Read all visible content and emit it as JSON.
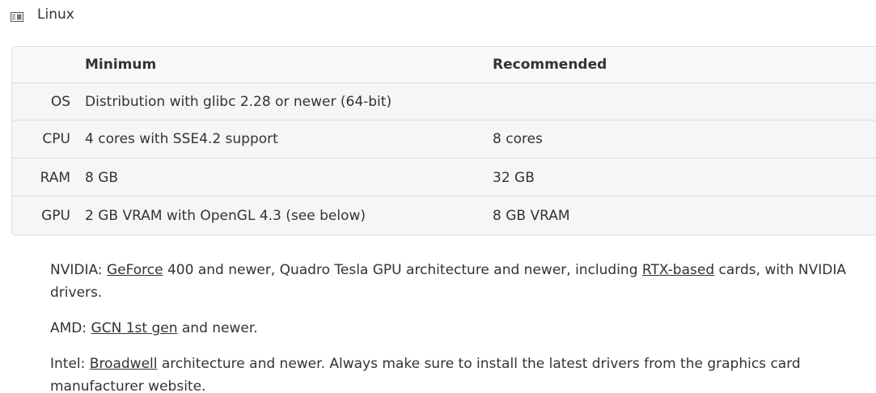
{
  "section": {
    "title": "Linux",
    "icon": "platform-icon"
  },
  "table": {
    "headers": {
      "label": "",
      "minimum": "Minimum",
      "recommended": "Recommended"
    },
    "rows": [
      {
        "label": "OS",
        "minimum": "Distribution with glibc 2.28 or newer (64-bit)",
        "recommended": ""
      },
      {
        "label": "CPU",
        "minimum": "4 cores with SSE4.2 support",
        "recommended": "8 cores"
      },
      {
        "label": "RAM",
        "minimum": "8 GB",
        "recommended": "32 GB"
      },
      {
        "label": "GPU",
        "minimum": "2 GB VRAM with OpenGL 4.3 (see below)",
        "recommended": "8 GB VRAM"
      }
    ]
  },
  "notes": {
    "nvidia": {
      "prefix": "NVIDIA: ",
      "link1": "GeForce",
      "middle": " 400 and newer, Quadro Tesla GPU architecture and newer, including ",
      "link2": "RTX-based",
      "suffix": " cards, with NVIDIA drivers."
    },
    "amd": {
      "prefix": "AMD: ",
      "link": "GCN 1st gen",
      "suffix": " and newer."
    },
    "intel": {
      "prefix": "Intel: ",
      "link": "Broadwell",
      "suffix": " architecture and newer. Always make sure to install the latest drivers from the graphics card manufacturer website."
    }
  }
}
